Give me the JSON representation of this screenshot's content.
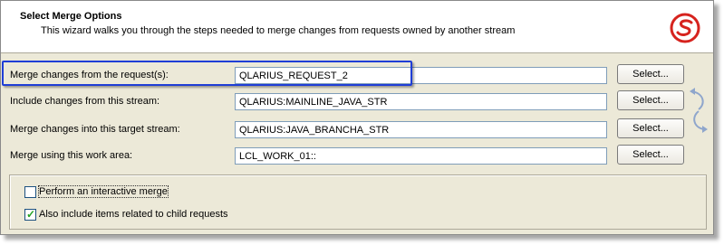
{
  "header": {
    "title": "Select Merge Options",
    "description": "This wizard walks you through the steps needed to merge changes from requests owned by another stream",
    "logo_icon": "serena-logo-icon"
  },
  "rows": [
    {
      "label": "Merge changes from the request(s):",
      "value": "QLARIUS_REQUEST_2",
      "button": "Select..."
    },
    {
      "label": "Include changes from this stream:",
      "value": "QLARIUS:MAINLINE_JAVA_STR",
      "button": "Select..."
    },
    {
      "label": "Merge changes into this target stream:",
      "value": "QLARIUS:JAVA_BRANCHA_STR",
      "button": "Select..."
    },
    {
      "label": "Merge using this work area:",
      "value": "LCL_WORK_01::",
      "button": "Select..."
    }
  ],
  "options": [
    {
      "label": "Perform an interactive merge",
      "checked": false
    },
    {
      "label": "Also include items related to child requests",
      "checked": true
    }
  ],
  "colors": {
    "highlight": "#1f3ed6",
    "logo": "#d6231e",
    "swap_arrows": "#8fa6cc"
  },
  "icons": {
    "swap": "swap-arrows-icon",
    "checkmark": "checkmark-icon"
  }
}
